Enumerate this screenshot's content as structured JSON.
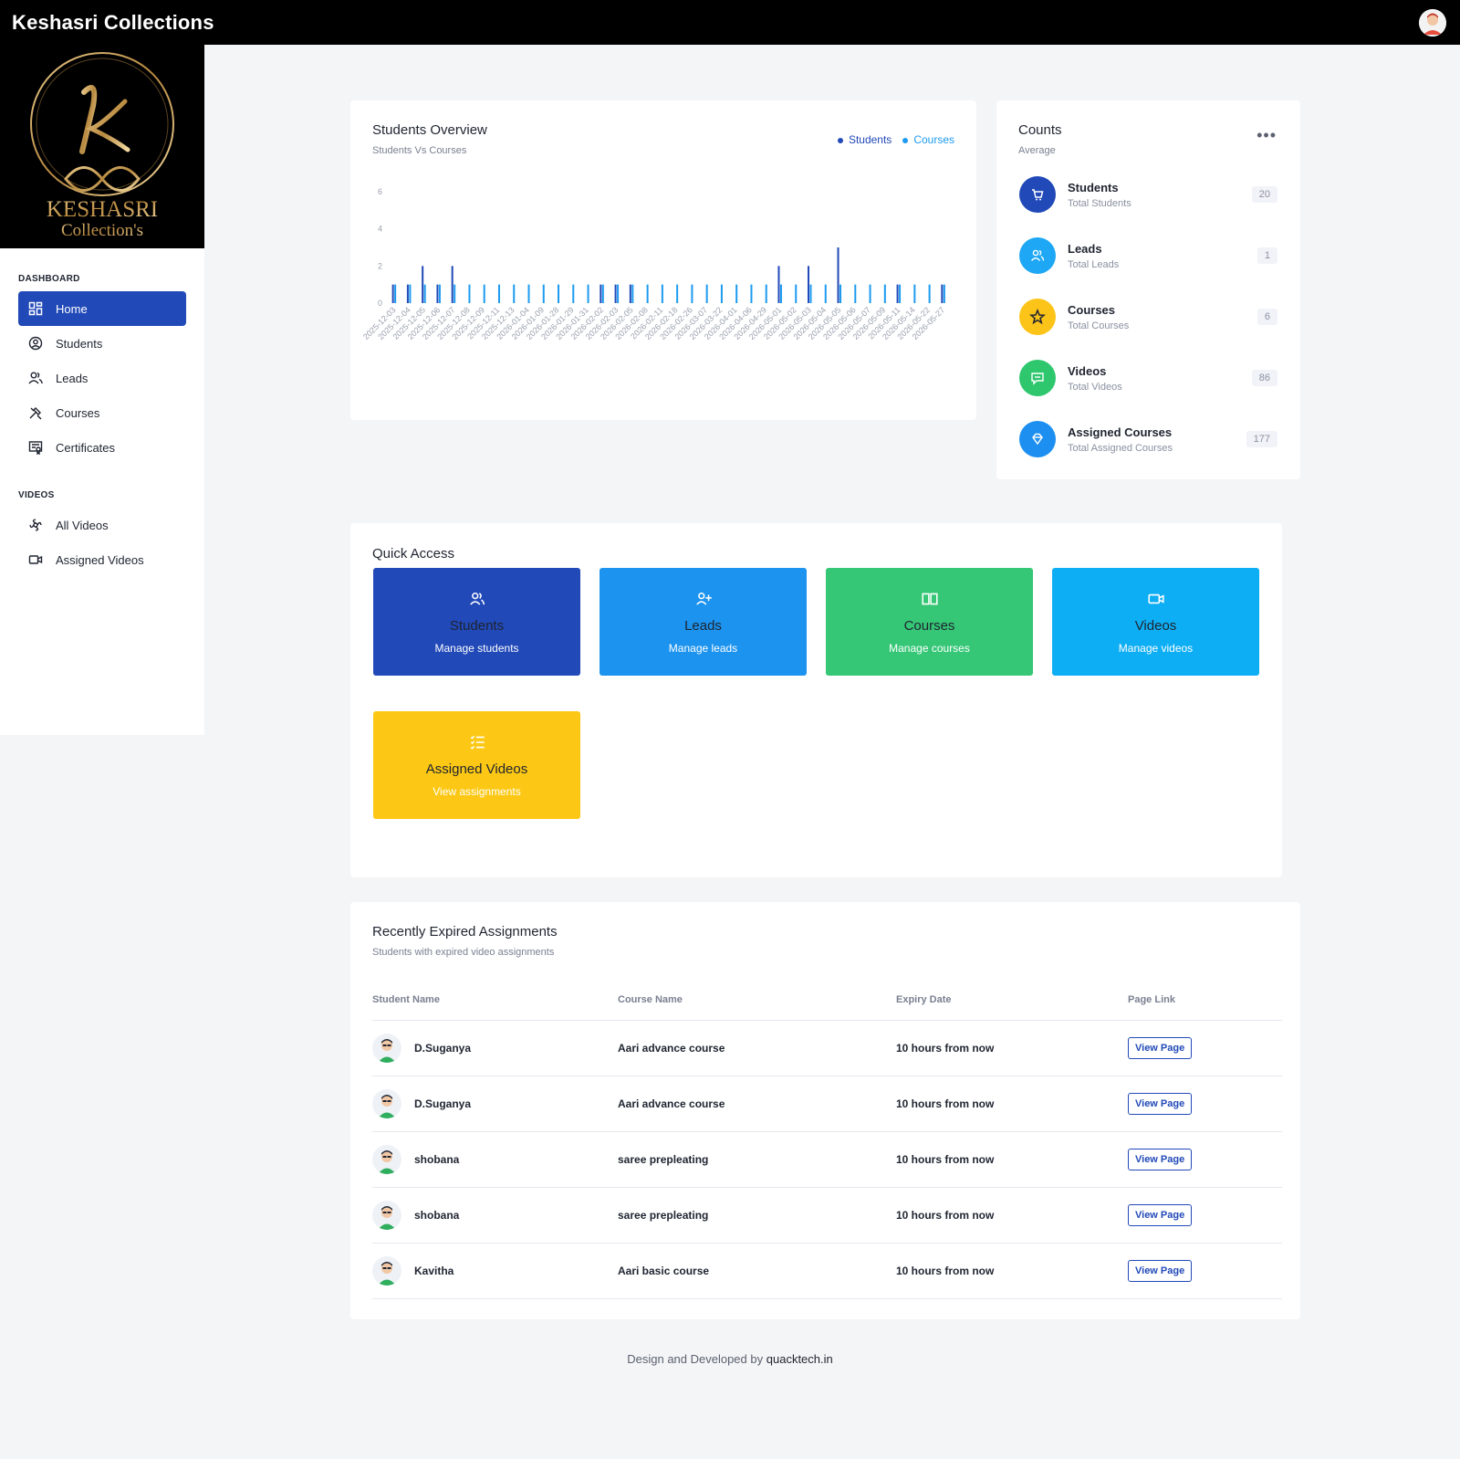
{
  "header": {
    "brand": "Keshasri Collections"
  },
  "logo": {
    "text_line1": "KESHASRI",
    "text_line2": "Collection's"
  },
  "sidebar": {
    "section_dashboard": "DASHBOARD",
    "section_videos": "VIDEOS",
    "items": [
      {
        "label": "Home",
        "icon": "dashboard-icon",
        "active": true
      },
      {
        "label": "Students",
        "icon": "user-circle-icon"
      },
      {
        "label": "Leads",
        "icon": "users-icon"
      },
      {
        "label": "Courses",
        "icon": "tools-icon"
      },
      {
        "label": "Certificates",
        "icon": "certificate-icon"
      }
    ],
    "video_items": [
      {
        "label": "All Videos",
        "icon": "film-icon"
      },
      {
        "label": "Assigned Videos",
        "icon": "video-icon"
      }
    ]
  },
  "overview": {
    "title": "Students Overview",
    "subtitle": "Students Vs Courses",
    "legend_students": "Students",
    "legend_courses": "Courses"
  },
  "chart_data": {
    "type": "bar",
    "title": "Students Overview",
    "subtitle": "Students Vs Courses",
    "ylim": [
      0,
      6
    ],
    "yticks": [
      0,
      2,
      4,
      6
    ],
    "grid": false,
    "legend": "top-right",
    "categories": [
      "2025-12-03",
      "2025-12-04",
      "2025-12-05",
      "2025-12-06",
      "2025-12-07",
      "2025-12-08",
      "2025-12-09",
      "2025-12-11",
      "2025-12-13",
      "2026-01-04",
      "2026-01-09",
      "2026-01-28",
      "2026-01-29",
      "2026-01-31",
      "2026-02-02",
      "2026-02-03",
      "2026-02-05",
      "2026-02-08",
      "2026-02-11",
      "2026-02-18",
      "2026-02-26",
      "2026-03-07",
      "2026-03-22",
      "2026-04-01",
      "2026-04-06",
      "2026-04-29",
      "2026-05-01",
      "2026-05-02",
      "2026-05-03",
      "2026-05-04",
      "2026-05-05",
      "2026-05-06",
      "2026-05-07",
      "2026-05-09",
      "2026-05-11",
      "2026-05-14",
      "2026-05-22",
      "2026-05-27"
    ],
    "series": [
      {
        "name": "Students",
        "values": [
          1,
          1,
          2,
          1,
          2,
          0,
          0,
          0,
          0,
          0,
          0,
          0,
          0,
          0,
          1,
          1,
          1,
          0,
          0,
          0,
          0,
          0,
          0,
          0,
          0,
          0,
          2,
          0,
          2,
          0,
          3,
          0,
          0,
          0,
          1,
          0,
          0,
          1
        ]
      },
      {
        "name": "Courses",
        "values": [
          1,
          1,
          1,
          1,
          1,
          1,
          1,
          1,
          1,
          1,
          1,
          1,
          1,
          1,
          1,
          1,
          1,
          1,
          1,
          1,
          1,
          1,
          1,
          1,
          1,
          1,
          1,
          1,
          1,
          1,
          1,
          1,
          1,
          1,
          1,
          1,
          1,
          1
        ]
      }
    ],
    "colors": {
      "Students": "#2149b8",
      "Courses": "#1d9bf0"
    }
  },
  "counts": {
    "title": "Counts",
    "subtitle": "Average",
    "items": [
      {
        "name": "Students",
        "desc": "Total Students",
        "value": "20",
        "color": "#2149b8",
        "icon": "cart-icon"
      },
      {
        "name": "Leads",
        "desc": "Total Leads",
        "value": "1",
        "color": "#1ea7f5",
        "icon": "users-icon"
      },
      {
        "name": "Courses",
        "desc": "Total Courses",
        "value": "6",
        "color": "#fcc419",
        "icon": "star-icon"
      },
      {
        "name": "Videos",
        "desc": "Total Videos",
        "value": "86",
        "color": "#2fc76e",
        "icon": "chat-icon"
      },
      {
        "name": "Assigned Courses",
        "desc": "Total Assigned Courses",
        "value": "177",
        "color": "#1d8ff0",
        "icon": "diamond-icon"
      }
    ]
  },
  "quick_access": {
    "title": "Quick Access",
    "tiles": [
      {
        "name": "Students",
        "desc": "Manage students",
        "color": "#2149b8",
        "icon": "users-icon"
      },
      {
        "name": "Leads",
        "desc": "Manage leads",
        "color": "#1b93ef",
        "icon": "user-plus-icon"
      },
      {
        "name": "Courses",
        "desc": "Manage courses",
        "color": "#35c776",
        "icon": "book-icon"
      },
      {
        "name": "Videos",
        "desc": "Manage videos",
        "color": "#0eaef5",
        "icon": "video-icon"
      },
      {
        "name": "Assigned Videos",
        "desc": "View assignments",
        "color": "#fcc815",
        "icon": "list-icon"
      }
    ]
  },
  "expired": {
    "title": "Recently Expired Assignments",
    "subtitle": "Students with expired video assignments",
    "columns": [
      "Student Name",
      "Course Name",
      "Expiry Date",
      "Page Link"
    ],
    "rows": [
      {
        "student": "D.Suganya",
        "course": "Aari advance course",
        "expiry": "10 hours from now",
        "link": "View Page"
      },
      {
        "student": "D.Suganya",
        "course": "Aari advance course",
        "expiry": "10 hours from now",
        "link": "View Page"
      },
      {
        "student": "shobana",
        "course": "saree prepleating",
        "expiry": "10 hours from now",
        "link": "View Page"
      },
      {
        "student": "shobana",
        "course": "saree prepleating",
        "expiry": "10 hours from now",
        "link": "View Page"
      },
      {
        "student": "Kavitha",
        "course": "Aari basic course",
        "expiry": "10 hours from now",
        "link": "View Page"
      }
    ]
  },
  "footer": {
    "prefix": "Design and Developed by",
    "company": "quacktech.in"
  }
}
